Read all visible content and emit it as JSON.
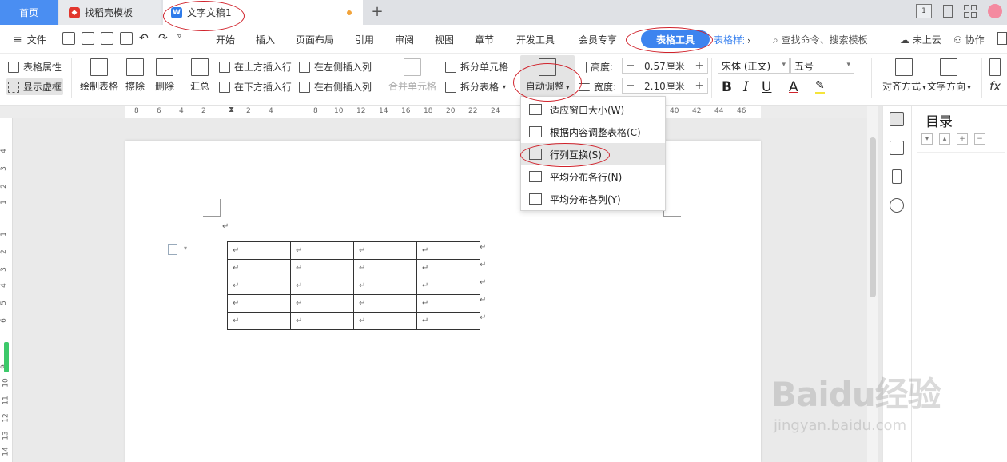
{
  "tabs": {
    "home": "首页",
    "daoke": "找稻壳模板",
    "doc": "文字文稿1",
    "new_tab": "+",
    "window_badge": "1"
  },
  "menu": {
    "file": "文件",
    "items": [
      "开始",
      "插入",
      "页面布局",
      "引用",
      "审阅",
      "视图",
      "章节",
      "开发工具",
      "会员专享"
    ],
    "table_tool": "表格工具",
    "table_style": "表格样式",
    "search": "查找命令、搜索模板",
    "cloud": "未上云",
    "collab": "协作"
  },
  "ribbon": {
    "table_props": "表格属性",
    "show_grid": "显示虚框",
    "draw_table": "绘制表格",
    "erase": "擦除",
    "delete": "删除",
    "summary": "汇总",
    "insert_above": "在上方插入行",
    "insert_below": "在下方插入行",
    "insert_left": "在左侧插入列",
    "insert_right": "在右侧插入列",
    "merge_cells": "合并单元格",
    "split_cells": "拆分单元格",
    "split_table": "拆分表格",
    "auto_fit": "自动调整",
    "height_label": "高度:",
    "height_value": "0.57厘米",
    "width_label": "宽度:",
    "width_value": "2.10厘米",
    "font_name": "宋体 (正文)",
    "font_size": "五号",
    "bold": "B",
    "italic": "I",
    "underline": "U",
    "font_color": "A",
    "align": "对齐方式",
    "text_dir": "文字方向",
    "minus": "−",
    "plus": "+"
  },
  "ruler": {
    "h_ticks": [
      "8",
      "6",
      "4",
      "2",
      "2",
      "4",
      "8",
      "10",
      "12",
      "14",
      "16",
      "18",
      "20",
      "22",
      "24",
      "40",
      "42",
      "44",
      "46"
    ],
    "v_ticks": [
      "4",
      "3",
      "2",
      "1",
      "1",
      "2",
      "3",
      "4",
      "5",
      "6",
      "9",
      "10",
      "11",
      "12",
      "13",
      "14"
    ]
  },
  "dropdown": {
    "items": [
      "适应窗口大小(W)",
      "根据内容调整表格(C)",
      "行列互换(S)",
      "平均分布各行(N)",
      "平均分布各列(Y)"
    ]
  },
  "toc": {
    "title": "目录"
  },
  "watermark": {
    "main": "Baidu经验",
    "sub": "jingyan.baidu.com"
  },
  "document": {
    "para_mark": "↵",
    "rows": 5,
    "cols": 4
  },
  "colors": {
    "accent": "#3d84ef",
    "annotation": "#d0222b",
    "home_tab": "#4a8ef2"
  }
}
